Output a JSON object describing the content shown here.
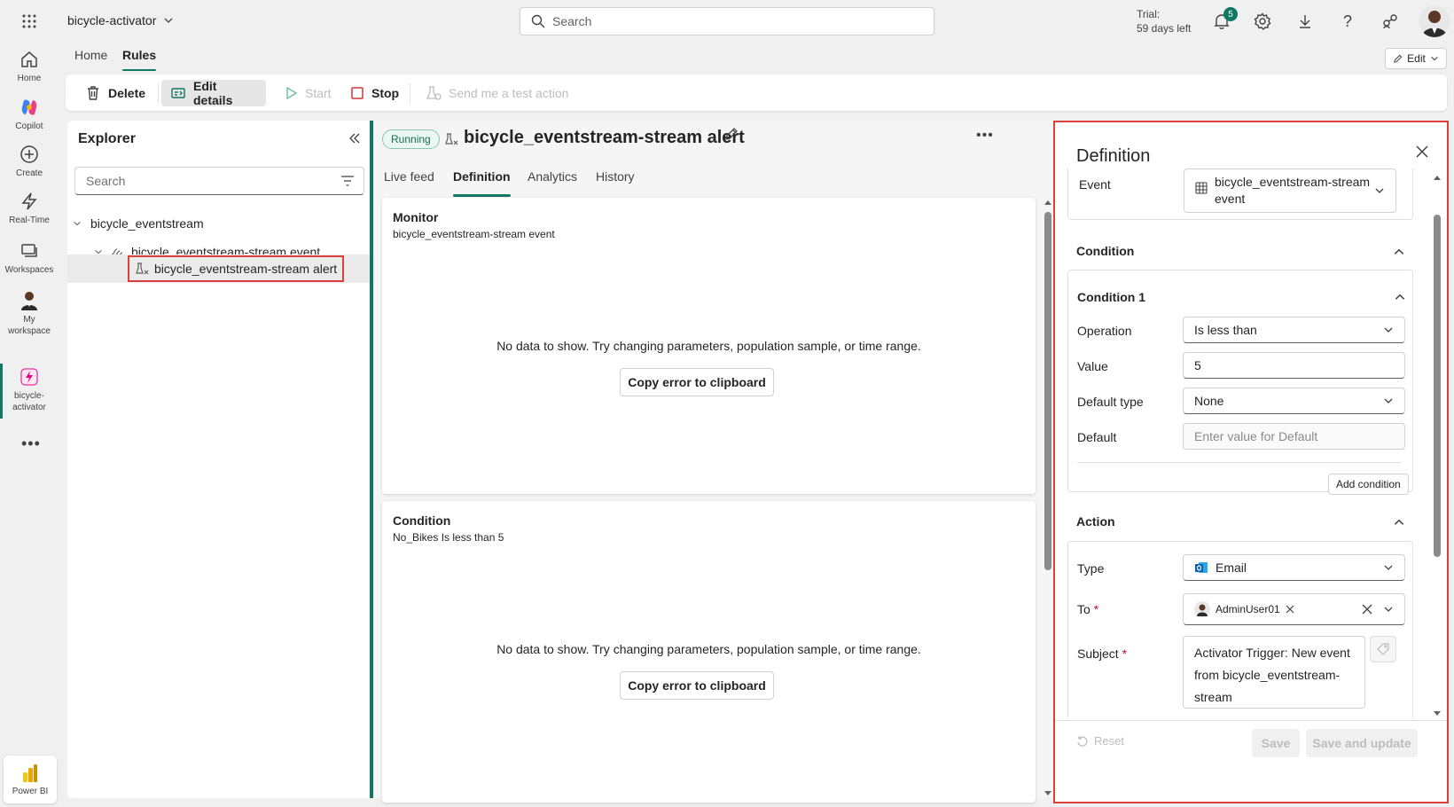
{
  "rail": {
    "items": [
      {
        "label": "Home",
        "icon": "home-icon"
      },
      {
        "label": "Copilot",
        "icon": "copilot-icon"
      },
      {
        "label": "Create",
        "icon": "create-icon"
      },
      {
        "label": "Real-Time",
        "icon": "lightning-icon"
      },
      {
        "label": "Workspaces",
        "icon": "workspaces-icon"
      },
      {
        "label": "My workspace",
        "icon": "avatar-icon"
      },
      {
        "label": "bicycle-activator",
        "icon": "activator-icon"
      }
    ],
    "bottom_label": "Power BI"
  },
  "topbar": {
    "app_name": "bicycle-activator",
    "search_placeholder": "Search",
    "trial_line1": "Trial:",
    "trial_line2": "59 days left",
    "notification_count": "5",
    "edit_label": "Edit"
  },
  "nav_tabs": [
    "Home",
    "Rules"
  ],
  "toolbar": {
    "delete": "Delete",
    "edit_details": "Edit details",
    "start": "Start",
    "stop": "Stop",
    "send_test": "Send me a test action"
  },
  "explorer": {
    "title": "Explorer",
    "search_placeholder": "Search",
    "tree": {
      "root": "bicycle_eventstream",
      "event": "bicycle_eventstream-stream event",
      "alert": "bicycle_eventstream-stream alert"
    }
  },
  "rule": {
    "status": "Running",
    "title": "bicycle_eventstream-stream alert",
    "tabs": [
      "Live feed",
      "Definition",
      "Analytics",
      "History"
    ],
    "active_tab": "Definition",
    "cards": [
      {
        "title": "Monitor",
        "subtitle": "bicycle_eventstream-stream event",
        "message": "No data to show. Try changing parameters, population sample, or time range.",
        "button": "Copy error to clipboard"
      },
      {
        "title": "Condition",
        "subtitle": "No_Bikes Is less than 5",
        "message": "No data to show. Try changing parameters, population sample, or time range.",
        "button": "Copy error to clipboard"
      }
    ]
  },
  "definition": {
    "title": "Definition",
    "event_label": "Event",
    "event_value_line1": "bicycle_eventstream-stream",
    "event_value_line2": "event",
    "condition_header": "Condition",
    "condition1_header": "Condition 1",
    "operation_label": "Operation",
    "operation_value": "Is less than",
    "value_label": "Value",
    "value_value": "5",
    "default_type_label": "Default type",
    "default_type_value": "None",
    "default_label": "Default",
    "default_placeholder": "Enter value for Default",
    "add_condition": "Add condition",
    "action_header": "Action",
    "type_label": "Type",
    "type_value": "Email",
    "to_label": "To",
    "to_value": "AdminUser01",
    "subject_label": "Subject",
    "subject_line1": "Activator Trigger: New event",
    "subject_line2": "from bicycle_eventstream-",
    "subject_line3": "stream",
    "reset": "Reset",
    "save": "Save",
    "save_update": "Save and update"
  },
  "colors": {
    "accent": "#117865",
    "highlight": "#d9413a",
    "badge": "#117865"
  }
}
